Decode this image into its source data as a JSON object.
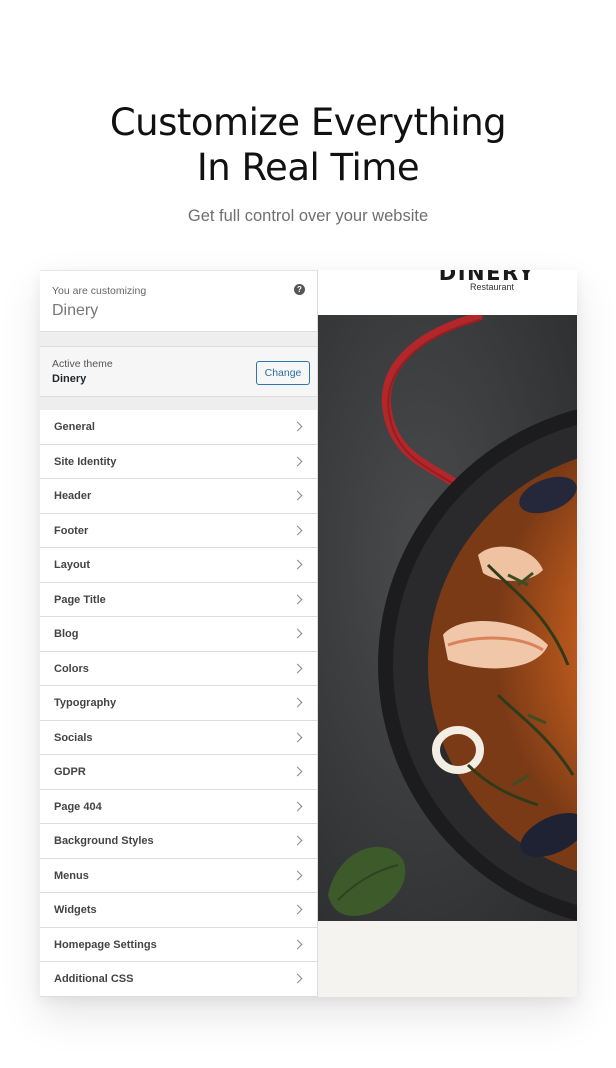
{
  "headline": {
    "line1": "Customize Everything",
    "line2": "In Real Time",
    "subtitle": "Get full control over your website"
  },
  "customizer": {
    "label": "You are customizing",
    "site_name": "Dinery",
    "help_icon": "question-circle-icon",
    "active_theme_label": "Active theme",
    "active_theme_name": "Dinery",
    "change_button": "Change",
    "menu_items": [
      {
        "label": "General"
      },
      {
        "label": "Site Identity"
      },
      {
        "label": "Header"
      },
      {
        "label": "Footer"
      },
      {
        "label": "Layout"
      },
      {
        "label": "Page Title"
      },
      {
        "label": "Blog"
      },
      {
        "label": "Colors"
      },
      {
        "label": "Typography"
      },
      {
        "label": "Socials"
      },
      {
        "label": "GDPR"
      },
      {
        "label": "Page 404"
      },
      {
        "label": "Background Styles"
      },
      {
        "label": "Menus"
      },
      {
        "label": "Widgets"
      },
      {
        "label": "Homepage Settings"
      },
      {
        "label": "Additional CSS"
      }
    ]
  },
  "preview": {
    "logo": "DINERY",
    "logo_sub": "Restaurant",
    "hero_image": "paella-pan-photo"
  },
  "colors": {
    "accent": "#2e74b5",
    "pan_handle": "#b3262a",
    "hero_bg": "#3b3c3e"
  }
}
